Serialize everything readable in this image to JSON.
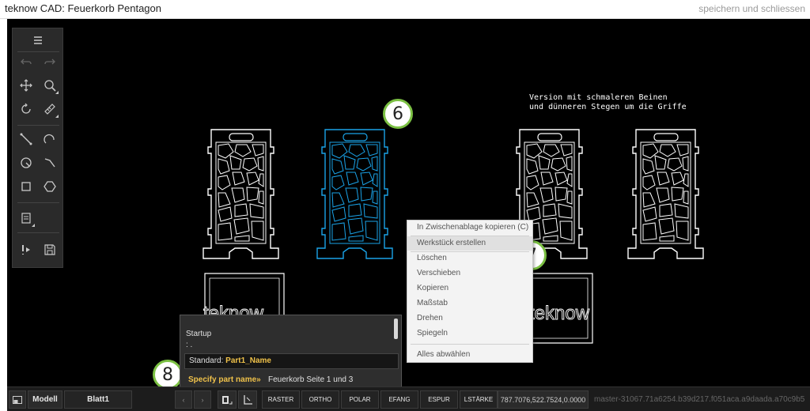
{
  "window": {
    "title": "teknow CAD: Feuerkorb Pentagon",
    "save_label": "speichern und schliessen"
  },
  "canvas": {
    "annotation_line1": "Version mit schmaleren Beinen",
    "annotation_line2": "und dünneren Stegen um die Griffe",
    "logo_text_left": "teknow",
    "logo_text_right": "teknow"
  },
  "callouts": {
    "six": "6",
    "seven": "7",
    "eight": "8"
  },
  "toolbar": {
    "icons": [
      "menu-icon",
      "undo-icon",
      "redo-icon",
      "move-icon",
      "zoom-icon",
      "rotate-icon",
      "measure-icon",
      "line-icon",
      "arc-icon",
      "circle-icon",
      "polyline-icon",
      "rectangle-icon",
      "polygon-icon",
      "layers-icon",
      "run-icon",
      "save-icon"
    ]
  },
  "context_menu": {
    "items": [
      "In Zwischenablage kopieren (C)",
      "Werkstück erstellen",
      "Löschen",
      "Verschieben",
      "Kopieren",
      "Maßstab",
      "Drehen",
      "Spiegeln",
      "Alles abwählen"
    ],
    "highlighted": "Werkstück erstellen"
  },
  "command_panel": {
    "history_line1": "Startup",
    "history_line2": ": .",
    "input_label": "Standard:",
    "input_value": "Part1_Name",
    "prompt": "Specify part name»",
    "answer": "Feuerkorb Seite 1 und 3"
  },
  "statusbar": {
    "tab_model": "Modell",
    "tab_sheet": "Blatt1",
    "nav_prev": "‹",
    "nav_next": "›",
    "toggles": [
      "RASTER",
      "ORTHO",
      "POLAR",
      "EFANG",
      "ESPUR",
      "LSTÄRKE"
    ],
    "coordinates": "787.7076,522.7524,0.0000",
    "master": "master-31067.71a6254.b39d217.f051aca.a9daada.a70c9b5"
  },
  "colors": {
    "canvas_bg": "#000000",
    "line_white": "#ffffff",
    "selected_blue": "#1aa3e8",
    "callout_green": "#7bc043",
    "prompt_yellow": "#f0c24a"
  }
}
